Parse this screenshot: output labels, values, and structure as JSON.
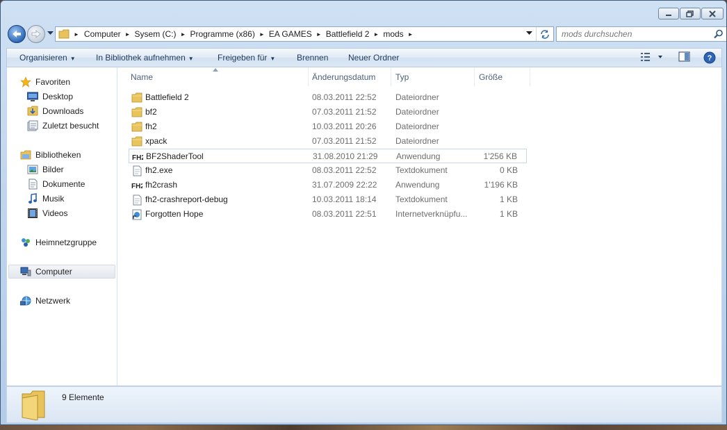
{
  "window": {
    "caption_buttons": [
      "minimize-icon",
      "maximize-icon",
      "close-icon"
    ]
  },
  "nav": {
    "breadcrumb": [
      "Computer",
      "Sysem (C:)",
      "Programme (x86)",
      "EA GAMES",
      "Battlefield 2",
      "mods"
    ],
    "search_placeholder": "mods durchsuchen"
  },
  "toolbar": {
    "organize": "Organisieren",
    "library": "In Bibliothek aufnehmen",
    "share": "Freigeben für",
    "burn": "Brennen",
    "new_folder": "Neuer Ordner"
  },
  "sidebar": {
    "favorites": "Favoriten",
    "desktop": "Desktop",
    "downloads": "Downloads",
    "recent": "Zuletzt besucht",
    "libraries": "Bibliotheken",
    "pictures": "Bilder",
    "documents": "Dokumente",
    "music": "Musik",
    "videos": "Videos",
    "homegroup": "Heimnetzgruppe",
    "computer": "Computer",
    "network": "Netzwerk"
  },
  "columns": {
    "name": "Name",
    "date": "Änderungsdatum",
    "type": "Typ",
    "size": "Größe"
  },
  "files": [
    {
      "name": "Battlefield 2",
      "date": "08.03.2011 22:52",
      "type": "Dateiordner",
      "size": "",
      "icon": "folder-icon"
    },
    {
      "name": "bf2",
      "date": "07.03.2011 21:52",
      "type": "Dateiordner",
      "size": "",
      "icon": "folder-icon"
    },
    {
      "name": "fh2",
      "date": "10.03.2011 20:26",
      "type": "Dateiordner",
      "size": "",
      "icon": "folder-icon"
    },
    {
      "name": "xpack",
      "date": "07.03.2011 21:52",
      "type": "Dateiordner",
      "size": "",
      "icon": "folder-icon"
    },
    {
      "name": "BF2ShaderTool",
      "date": "31.08.2010 21:29",
      "type": "Anwendung",
      "size": "1'256 KB",
      "icon": "fh2-app-icon"
    },
    {
      "name": "fh2.exe",
      "date": "08.03.2011 22:52",
      "type": "Textdokument",
      "size": "0 KB",
      "icon": "text-document-icon"
    },
    {
      "name": "fh2crash",
      "date": "31.07.2009 22:22",
      "type": "Anwendung",
      "size": "1'196 KB",
      "icon": "fh2-app-icon"
    },
    {
      "name": "fh2-crashreport-debug",
      "date": "10.03.2011 18:14",
      "type": "Textdokument",
      "size": "1 KB",
      "icon": "text-document-icon"
    },
    {
      "name": "Forgotten Hope",
      "date": "08.03.2011 22:51",
      "type": "Internetverknüpfu...",
      "size": "1 KB",
      "icon": "internet-shortcut-icon"
    }
  ],
  "fh2_logo": "FH2",
  "status": {
    "count": "9 Elemente"
  },
  "colors": {
    "frame": "#bcd3ec",
    "toolbar_text": "#1e395b",
    "secondary_text": "#6d6d6d"
  }
}
